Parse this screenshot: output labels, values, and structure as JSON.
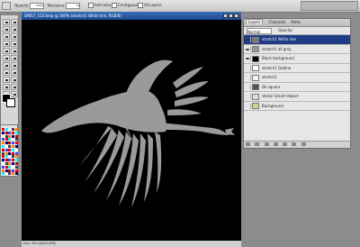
{
  "options_bar": {
    "opacity_label": "Opacity:",
    "opacity_value": "100%",
    "tolerance_label": "Tolerance:",
    "tolerance_value": "32",
    "antialias_label": "Anti-alias",
    "contiguous_label": "Contiguous",
    "all_layers_label": "All Layers"
  },
  "document": {
    "title": "SP817_153.bmp @ 300% (stretch1 White line, RGB/8)",
    "status": "Doc: 352.0K/25.09M"
  },
  "layers_panel": {
    "tabs": [
      "Layers",
      "Channels",
      "Paths"
    ],
    "blend_mode": "Normal",
    "opacity_label": "Opacity:",
    "layers": [
      {
        "name": "stretch1 White line",
        "selected": true,
        "visible": true,
        "thumb": "#7a7a7a"
      },
      {
        "name": "stretch1 all grey",
        "selected": false,
        "visible": true,
        "thumb": "#9a9a9a"
      },
      {
        "name": "Black background",
        "selected": false,
        "visible": true,
        "thumb": "#000000"
      },
      {
        "name": "stretch1 Outline",
        "selected": false,
        "visible": false,
        "thumb": "#ffffff"
      },
      {
        "name": "stretch1",
        "selected": false,
        "visible": false,
        "thumb": "#f4f4f4"
      },
      {
        "name": "Dk square",
        "selected": false,
        "visible": false,
        "thumb": "#555555"
      },
      {
        "name": "Vector Smart Object",
        "selected": false,
        "visible": false,
        "thumb": "#dcdcdc"
      },
      {
        "name": "Background",
        "selected": false,
        "visible": false,
        "thumb": "#d8cf8a"
      }
    ]
  },
  "colors": {
    "foreground": "#000000",
    "background": "#ffffff",
    "bird_fill": "#9a9a9a"
  }
}
